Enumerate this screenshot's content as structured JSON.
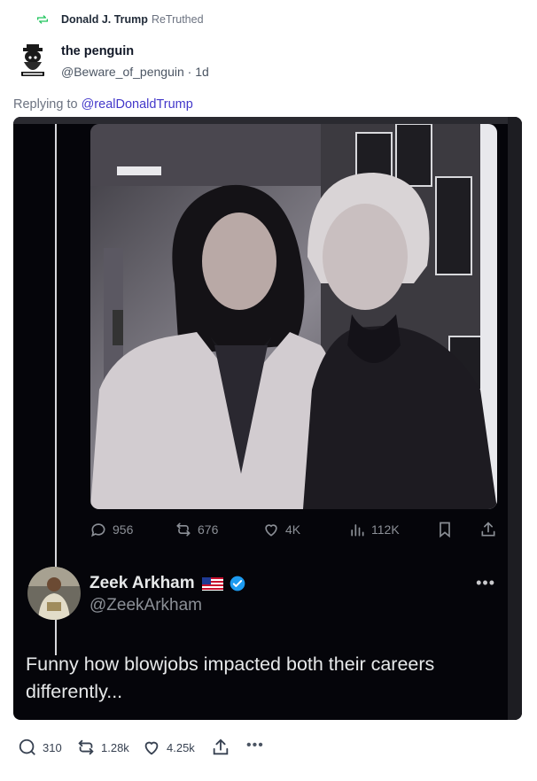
{
  "retruth": {
    "name": "Donald J. Trump",
    "suffix": "ReTruthed",
    "icon": "retruth-icon",
    "icon_color": "#22c55e"
  },
  "author": {
    "display_name": "the penguin",
    "handle": "@Beware_of_penguin",
    "separator": "·",
    "age": "1d"
  },
  "reply": {
    "prefix": "Replying to",
    "mention": "@realDonaldTrump"
  },
  "embedded_tweet": {
    "stats": {
      "replies": "956",
      "retweets": "676",
      "likes": "4K",
      "views": "112K"
    },
    "quote": {
      "name": "Zeek Arkham",
      "handle": "@ZeekArkham",
      "more": "•••",
      "text": "Funny how blowjobs impacted both their careers differently..."
    }
  },
  "actions": {
    "replies": "310",
    "retruths": "1.28k",
    "likes": "4.25k",
    "more": "•••"
  },
  "colors": {
    "accent": "#4338ca",
    "media_bg": "#05050a",
    "verified": "#1d9bf0"
  }
}
